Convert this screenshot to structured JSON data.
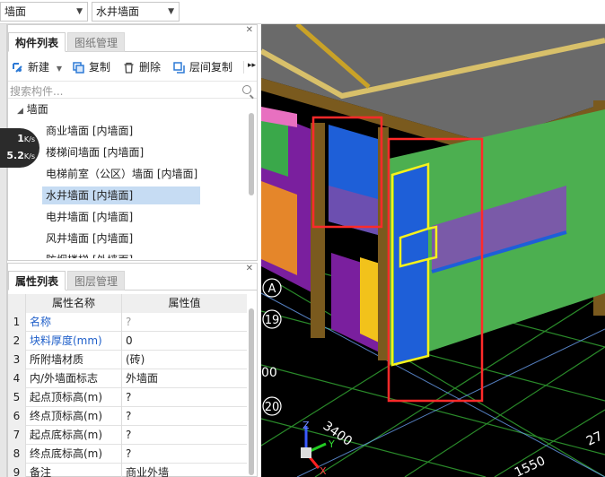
{
  "topbar": {
    "category_select": "墙面",
    "type_select": "水井墙面"
  },
  "component_pane": {
    "tabs": [
      {
        "label": "构件列表",
        "active": true
      },
      {
        "label": "图纸管理",
        "active": false
      }
    ],
    "toolbar": {
      "new_label": "新建",
      "copy_label": "复制",
      "delete_label": "删除",
      "floor_copy_label": "层间复制"
    },
    "search_placeholder": "搜索构件...",
    "tree": {
      "root_label": "墙面",
      "items": [
        {
          "label": "商业墙面 [内墙面]",
          "selected": false
        },
        {
          "label": "楼梯间墙面 [内墙面]",
          "selected": false
        },
        {
          "label": "电梯前室（公区）墙面 [内墙面]",
          "selected": false
        },
        {
          "label": "水井墙面 [内墙面]",
          "selected": true
        },
        {
          "label": "电井墙面 [内墙面]",
          "selected": false
        },
        {
          "label": "风井墙面 [内墙面]",
          "selected": false
        },
        {
          "label": "防烟楼梯 [外墙面]",
          "selected": false
        }
      ]
    }
  },
  "property_pane": {
    "tabs": [
      {
        "label": "属性列表",
        "active": true
      },
      {
        "label": "图层管理",
        "active": false
      }
    ],
    "headers": {
      "name": "属性名称",
      "value": "属性值"
    },
    "rows": [
      {
        "idx": "1",
        "name": "名称",
        "value": "?",
        "name_blue": true,
        "value_grey": true
      },
      {
        "idx": "2",
        "name": "块料厚度(mm)",
        "value": "0",
        "name_blue": true,
        "value_grey": false
      },
      {
        "idx": "3",
        "name": "所附墙材质",
        "value": "(砖)",
        "name_blue": false,
        "value_grey": false
      },
      {
        "idx": "4",
        "name": "内/外墙面标志",
        "value": "外墙面",
        "name_blue": false,
        "value_grey": false
      },
      {
        "idx": "5",
        "name": "起点顶标高(m)",
        "value": "?",
        "name_blue": false,
        "value_grey": false
      },
      {
        "idx": "6",
        "name": "终点顶标高(m)",
        "value": "?",
        "name_blue": false,
        "value_grey": false
      },
      {
        "idx": "7",
        "name": "起点底标高(m)",
        "value": "?",
        "name_blue": false,
        "value_grey": false
      },
      {
        "idx": "8",
        "name": "终点底标高(m)",
        "value": "?",
        "name_blue": false,
        "value_grey": false
      },
      {
        "idx": "9",
        "name": "备注",
        "value": "商业外墙",
        "name_blue": false,
        "value_grey": false
      }
    ]
  },
  "speed_overlay": {
    "upload": "1",
    "upload_unit": "K/s",
    "download": "5.2",
    "download_unit": "K/s"
  },
  "viewport": {
    "axis_labels": [
      "A",
      "19",
      "20"
    ],
    "partial_label": "00",
    "dimensions": [
      "3400",
      "1550",
      "27"
    ],
    "gizmo": {
      "z": "Z",
      "y": "Y",
      "x": "X"
    },
    "colors": {
      "wall_green": "#4caf50",
      "wall_blue": "#1e5fd8",
      "highlight_red": "#ff2a2a",
      "highlight_yellow": "#f5f21b",
      "column_brown": "#7a5a1e",
      "roof_grey": "#6a6a6a"
    }
  }
}
